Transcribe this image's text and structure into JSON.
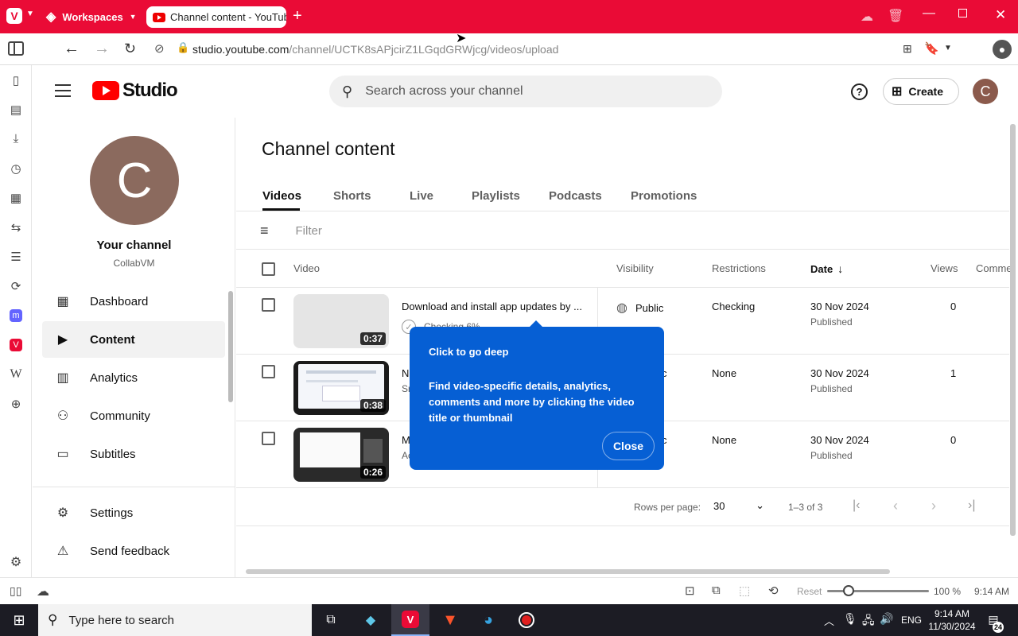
{
  "browser": {
    "workspaces_label": "Workspaces",
    "tab_title": "Channel content - YouTube",
    "new_tab": "+",
    "url_host": "studio.youtube.com",
    "url_path": "/channel/UCTK8sAPjcirZ1LGqdGRWjcg/videos/upload"
  },
  "header": {
    "logo_text": "Studio",
    "search_placeholder": "Search across your channel",
    "help": "?",
    "create_label": "Create",
    "avatar_letter": "C"
  },
  "sidebar": {
    "avatar_letter": "C",
    "channel_title": "Your channel",
    "channel_name": "CollabVM",
    "items": [
      {
        "label": "Dashboard",
        "icon": "dashboard-icon"
      },
      {
        "label": "Content",
        "icon": "content-icon",
        "active": true
      },
      {
        "label": "Analytics",
        "icon": "analytics-icon"
      },
      {
        "label": "Community",
        "icon": "community-icon"
      },
      {
        "label": "Subtitles",
        "icon": "subtitles-icon"
      }
    ],
    "bottom": [
      {
        "label": "Settings",
        "icon": "gear-icon"
      },
      {
        "label": "Send feedback",
        "icon": "feedback-icon"
      }
    ]
  },
  "main": {
    "page_title": "Channel content",
    "tabs": [
      "Videos",
      "Shorts",
      "Live",
      "Playlists",
      "Podcasts",
      "Promotions"
    ],
    "filter_placeholder": "Filter",
    "columns": {
      "video": "Video",
      "visibility": "Visibility",
      "restrictions": "Restrictions",
      "date": "Date",
      "views": "Views",
      "comments": "Comme"
    },
    "rows": [
      {
        "duration": "0:37",
        "title": "Download and install app updates by ...",
        "subtitle": "Checking 6%",
        "visibility": "Public",
        "restrictions": "Checking",
        "date": "30 Nov 2024",
        "date_status": "Published",
        "views": "0"
      },
      {
        "duration": "0:38",
        "title": "N",
        "subtitle": "Sr",
        "visibility": "c",
        "restrictions": "None",
        "date": "30 Nov 2024",
        "date_status": "Published",
        "views": "1"
      },
      {
        "duration": "0:26",
        "title": "M",
        "subtitle": "Ac",
        "visibility": "c",
        "restrictions": "None",
        "date": "30 Nov 2024",
        "date_status": "Published",
        "views": "0"
      }
    ],
    "pagination": {
      "rows_per_page_label": "Rows per page:",
      "rows_per_page": "30",
      "range": "1–3 of 3"
    }
  },
  "tooltip": {
    "title": "Click to go deep",
    "body": "Find video-specific details, analytics, comments and more by clicking the video title or thumbnail",
    "close_label": "Close"
  },
  "statusbar": {
    "reset_label": "Reset",
    "zoom": "100 %",
    "zoom_level": 1.0,
    "time": "9:14 AM"
  },
  "taskbar": {
    "search_placeholder": "Type here to search",
    "lang": "ENG",
    "time": "9:14 AM",
    "date": "11/30/2024",
    "notifications": "24"
  },
  "colors": {
    "browser_accent": "#ea0b36",
    "tooltip_blue": "#065fd4",
    "youtube_red": "#ff0000"
  }
}
